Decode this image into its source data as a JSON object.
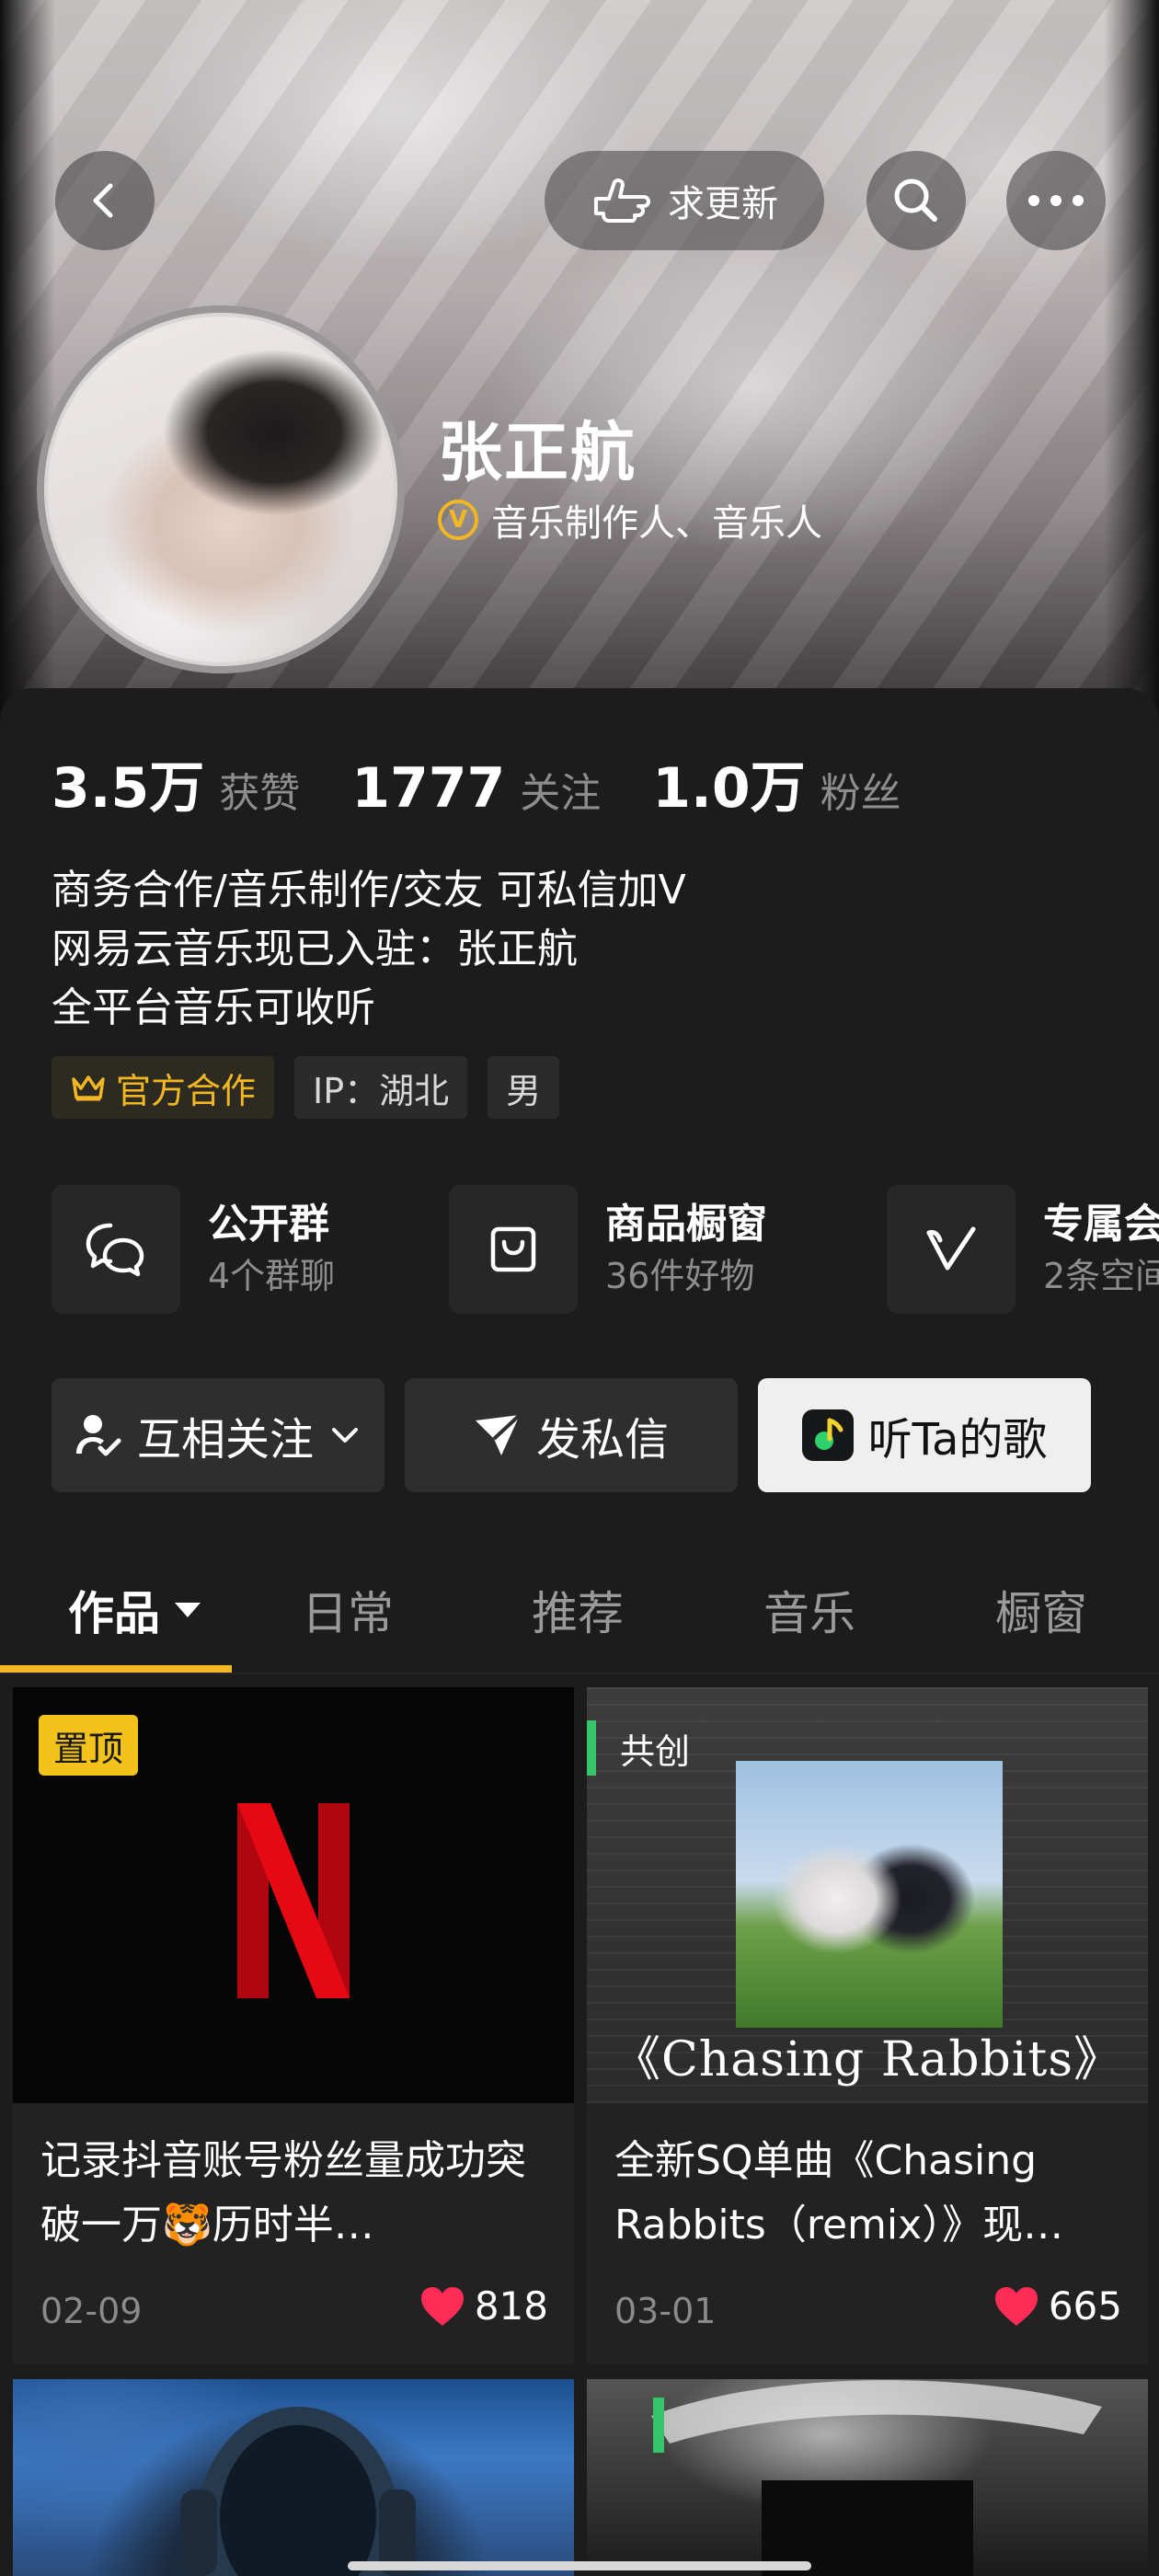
{
  "header": {
    "request_update_label": "求更新"
  },
  "profile": {
    "name": "张正航",
    "verification": "音乐制作人、音乐人",
    "stats": [
      {
        "value": "3.5万",
        "label": "获赞"
      },
      {
        "value": "1777",
        "label": "关注"
      },
      {
        "value": "1.0万",
        "label": "粉丝"
      }
    ],
    "bio_lines": [
      "商务合作/音乐制作/交友 可私信加V",
      "网易云音乐现已入驻：张正航",
      "全平台音乐可收听"
    ],
    "tags": [
      "官方合作",
      "IP：湖北",
      "男"
    ]
  },
  "features": [
    {
      "title": "公开群",
      "subtitle": "4个群聊",
      "icon": "chat-group-icon"
    },
    {
      "title": "商品橱窗",
      "subtitle": "36件好物",
      "icon": "shopping-bag-icon"
    },
    {
      "title": "专属会",
      "subtitle": "2条空间",
      "icon": "v-badge-icon"
    }
  ],
  "actions": {
    "follow": "互相关注",
    "message": "发私信",
    "listen": "听Ta的歌"
  },
  "tabs": [
    {
      "label": "作品",
      "active": true
    },
    {
      "label": "日常",
      "active": false
    },
    {
      "label": "推荐",
      "active": false
    },
    {
      "label": "音乐",
      "active": false
    },
    {
      "label": "橱窗",
      "active": false
    }
  ],
  "videos": [
    {
      "badge": "置顶",
      "title": "记录抖音账号粉丝量成功突破一万🐯历时半…",
      "date": "02-09",
      "likes": "818"
    },
    {
      "badge": "共创",
      "thumb_text": "《Chasing Rabbits》",
      "title": "全新SQ单曲《Chasing Rabbits（remix）》现…",
      "date": "03-01",
      "likes": "665"
    }
  ],
  "colors": {
    "accent": "#f3b723",
    "background": "#1c1c1c",
    "like": "#ff2d55"
  }
}
